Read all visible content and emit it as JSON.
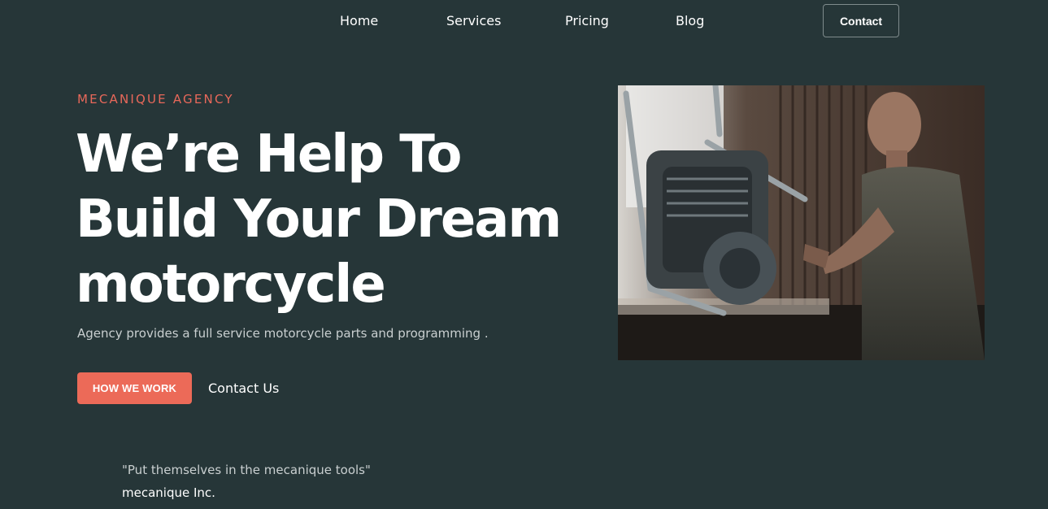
{
  "nav": {
    "items": [
      {
        "label": "Home"
      },
      {
        "label": "Services"
      },
      {
        "label": "Pricing"
      },
      {
        "label": "Blog"
      }
    ],
    "contact_label": "Contact"
  },
  "hero": {
    "eyebrow": "MECANIQUE AGENCY",
    "headline": "We’re Help To Build Your Dream motorcycle",
    "subtitle": "Agency provides a full service motorcycle parts and programming .",
    "primary_button": "HOW WE WORK",
    "secondary_link": "Contact Us",
    "image_icon": "mechanic-photo"
  },
  "testimonial": {
    "quote": "\"Put themselves in the mecanique tools\"",
    "author": "mecanique Inc."
  },
  "colors": {
    "background": "#263638",
    "accent": "#ec6a58",
    "text": "#ffffff",
    "muted": "#c9cfd0"
  }
}
